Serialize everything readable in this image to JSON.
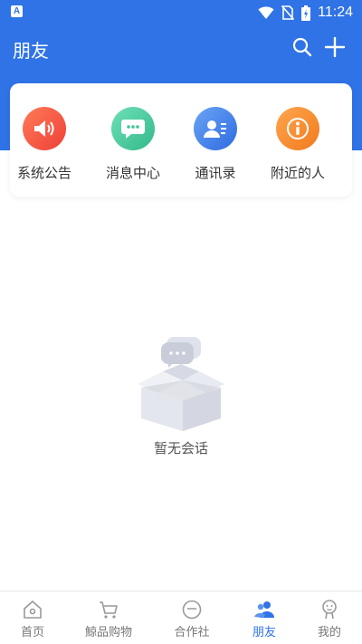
{
  "status_bar": {
    "app_icon_letter": "A",
    "time": "11:24"
  },
  "header": {
    "title": "朋友"
  },
  "quick_actions": [
    {
      "label": "系统公告",
      "color": "#f2573f",
      "icon": "speaker-icon"
    },
    {
      "label": "消息中心",
      "color": "#3fc497",
      "icon": "chat-bubble-icon"
    },
    {
      "label": "通讯录",
      "color": "#3b7de8",
      "icon": "contact-card-icon"
    },
    {
      "label": "附近的人",
      "color": "#f58b2c",
      "icon": "person-info-icon"
    }
  ],
  "empty_state": {
    "text": "暂无会话",
    "icon": "empty-box-icon"
  },
  "bottom_nav": {
    "active_color": "#2f73e6",
    "items": [
      {
        "label": "首页",
        "icon": "home-icon",
        "active": false
      },
      {
        "label": "鯨品购物",
        "icon": "cart-icon",
        "active": false
      },
      {
        "label": "合作社",
        "icon": "circle-minus-icon",
        "active": false
      },
      {
        "label": "朋友",
        "icon": "friends-icon",
        "active": true
      },
      {
        "label": "我的",
        "icon": "profile-icon",
        "active": false
      }
    ]
  }
}
